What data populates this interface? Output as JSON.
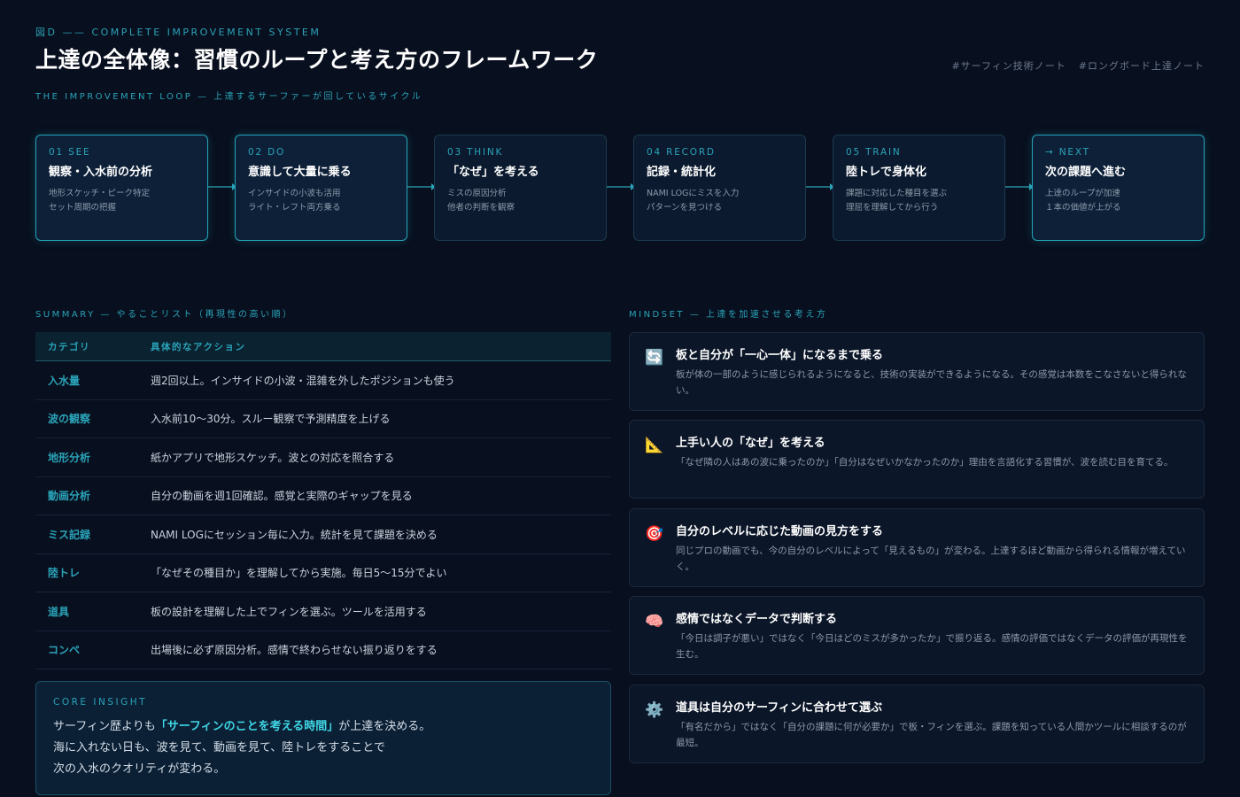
{
  "header": {
    "figure_label": "図D —— COMPLETE IMPROVEMENT SYSTEM",
    "title": "上達の全体像：習慣のループと考え方のフレームワーク",
    "tags": [
      "#サーフィン技術ノート",
      "#ロングボード上達ノート"
    ],
    "loop_label": "THE IMPROVEMENT LOOP — 上達するサーファーが回しているサイクル"
  },
  "steps": [
    {
      "num": "01 SEE",
      "title": "観察・入水前の分析",
      "desc1": "地形スケッチ・ピーク特定",
      "desc2": "セット周期の把握"
    },
    {
      "num": "02 DO",
      "title": "意識して大量に乗る",
      "desc1": "インサイドの小波も活用",
      "desc2": "ライト・レフト両方乗る"
    },
    {
      "num": "03 THINK",
      "title": "「なぜ」を考える",
      "desc1": "ミスの原因分析",
      "desc2": "他者の判断を観察"
    },
    {
      "num": "04 RECORD",
      "title": "記録・統計化",
      "desc1": "NAMI LOGにミスを入力",
      "desc2": "パターンを見つける"
    },
    {
      "num": "05 TRAIN",
      "title": "陸トレで身体化",
      "desc1": "課題に対応した種目を選ぶ",
      "desc2": "理屈を理解してから行う"
    },
    {
      "num": "→ NEXT",
      "title": "次の課題へ進む",
      "desc1": "上達のループが加速",
      "desc2": "１本の価値が上がる"
    }
  ],
  "summary": {
    "label": "SUMMARY — やることリスト（再現性の高い順）",
    "col_category": "カテゴリ",
    "col_action": "具体的なアクション",
    "rows": [
      {
        "category": "入水量",
        "action": "週2回以上。インサイドの小波・混雑を外したポジションも使う"
      },
      {
        "category": "波の観察",
        "action": "入水前10〜30分。スルー観察で予測精度を上げる"
      },
      {
        "category": "地形分析",
        "action": "紙かアプリで地形スケッチ。波との対応を照合する"
      },
      {
        "category": "動画分析",
        "action": "自分の動画を週1回確認。感覚と実際のギャップを見る"
      },
      {
        "category": "ミス記録",
        "action": "NAMI LOGにセッション毎に入力。統計を見て課題を決める"
      },
      {
        "category": "陸トレ",
        "action": "「なぜその種目か」を理解してから実施。毎日5〜15分でよい"
      },
      {
        "category": "道具",
        "action": "板の設計を理解した上でフィンを選ぶ。ツールを活用する"
      },
      {
        "category": "コンペ",
        "action": "出場後に必ず原因分析。感情で終わらせない振り返りをする"
      }
    ]
  },
  "insight": {
    "label": "CORE INSIGHT",
    "line1_pre": "サーフィン歴よりも",
    "line1_emph": "「サーフィンのことを考える時間」",
    "line1_post": "が上達を決める。",
    "line2": "海に入れない日も、波を見て、動画を見て、陸トレをすることで",
    "line3": "次の入水のクオリティが変わる。"
  },
  "mindset": {
    "label": "MINDSET — 上達を加速させる考え方",
    "cards": [
      {
        "icon": "🔄",
        "icon_name": "cycle-icon",
        "title": "板と自分が「一心一体」になるまで乗る",
        "desc": "板が体の一部のように感じられるようになると、技術の実装ができるようになる。その感覚は本数をこなさないと得られない。"
      },
      {
        "icon": "📐",
        "icon_name": "triangle-ruler-icon",
        "title": "上手い人の「なぜ」を考える",
        "desc": "「なぜ隣の人はあの波に乗ったのか」「自分はなぜいかなかったのか」理由を言語化する習慣が、波を読む目を育てる。"
      },
      {
        "icon": "🎯",
        "icon_name": "target-icon",
        "title": "自分のレベルに応じた動画の見方をする",
        "desc": "同じプロの動画でも、今の自分のレベルによって「見えるもの」が変わる。上達するほど動画から得られる情報が増えていく。"
      },
      {
        "icon": "🧠",
        "icon_name": "brain-icon",
        "title": "感情ではなくデータで判断する",
        "desc": "「今日は調子が悪い」ではなく「今日はどのミスが多かったか」で振り返る。感情の評価ではなくデータの評価が再現性を生む。"
      },
      {
        "icon": "⚙️",
        "icon_name": "gear-icon",
        "title": "道具は自分のサーフィンに合わせて選ぶ",
        "desc": "「有名だから」ではなく「自分の課題に何が必要か」で板・フィンを選ぶ。課題を知っている人間かツールに相談するのが最短。"
      }
    ]
  }
}
